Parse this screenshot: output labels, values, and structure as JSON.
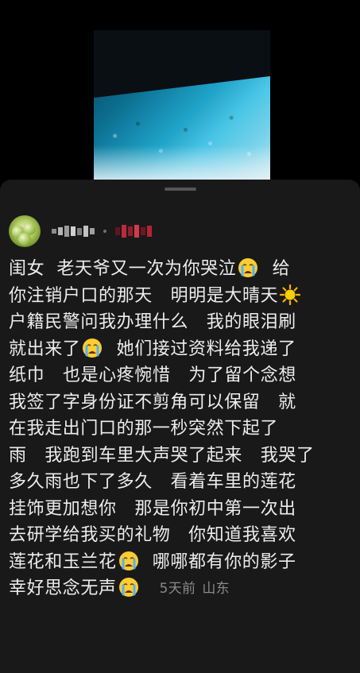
{
  "video": {
    "icon": "video-thumbnail-rain-on-car-window"
  },
  "comment": {
    "lines": [
      {
        "a": "闺女  老天爷又一次为你哭泣",
        "b": "  给"
      },
      {
        "a": "你注销户口的那天   明明是大晴天",
        "b": ""
      },
      {
        "a": "户籍民警问我办理什么   我的眼泪刷",
        "b": ""
      },
      {
        "a": "就出来了",
        "b": "  她们接过资料给我递了"
      },
      {
        "a": "纸巾   也是心疼惋惜   为了留个念想",
        "b": ""
      },
      {
        "a": "我签了字身份证不剪角可以保留   就",
        "b": ""
      },
      {
        "a": "在我走出门口的那一秒突然下起了",
        "b": ""
      },
      {
        "a": "雨   我跑到车里大声哭了起来   我哭了",
        "b": ""
      },
      {
        "a": "多久雨也下了多久   看着车里的莲花",
        "b": ""
      },
      {
        "a": "挂饰更加想你   那是你初中第一次出",
        "b": ""
      },
      {
        "a": "去研学给我买的礼物   你知道我喜欢",
        "b": ""
      },
      {
        "a": "莲花和玉兰花",
        "b": "  哪哪都有你的影子"
      },
      {
        "a": "幸好思念无声",
        "b": ""
      }
    ],
    "time": "5天前",
    "location": "山东",
    "emoji_names": [
      "crying-face-emoji",
      "sun-emoji"
    ]
  },
  "colors": {
    "panel": "#191919",
    "text": "#ededed",
    "meta": "#8a8a8a",
    "accent_blur": "#c0283c"
  }
}
